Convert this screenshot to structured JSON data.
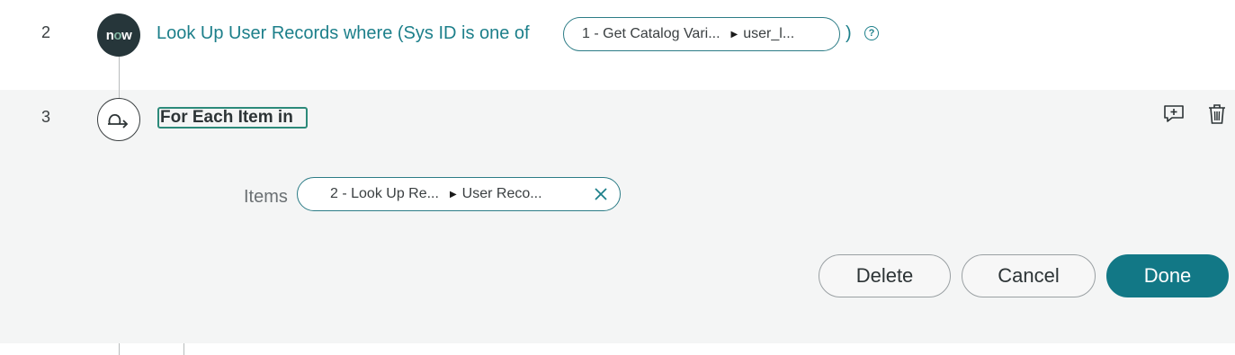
{
  "step2": {
    "number": "2",
    "icon_text_n": "n",
    "icon_text_o": "o",
    "icon_text_w": "w",
    "title": "Look Up User Records where (Sys ID is one of",
    "pill_left": "1 - Get Catalog Vari...",
    "pill_right": "user_l...",
    "close_paren": ")",
    "help_glyph": "?"
  },
  "step3": {
    "number": "3",
    "title": "For Each Item in",
    "items_label": "Items",
    "items_pill_left": "2 - Look Up Re...",
    "items_pill_right": "User Reco...",
    "actions": {
      "delete": "Delete",
      "cancel": "Cancel",
      "done": "Done"
    },
    "add_comment_icon": "add-comment-icon",
    "trash_icon": "trash-icon"
  },
  "colors": {
    "accent_teal": "#1c7f8a",
    "primary_button": "#127886",
    "edit_panel_bg": "#f4f5f5"
  }
}
